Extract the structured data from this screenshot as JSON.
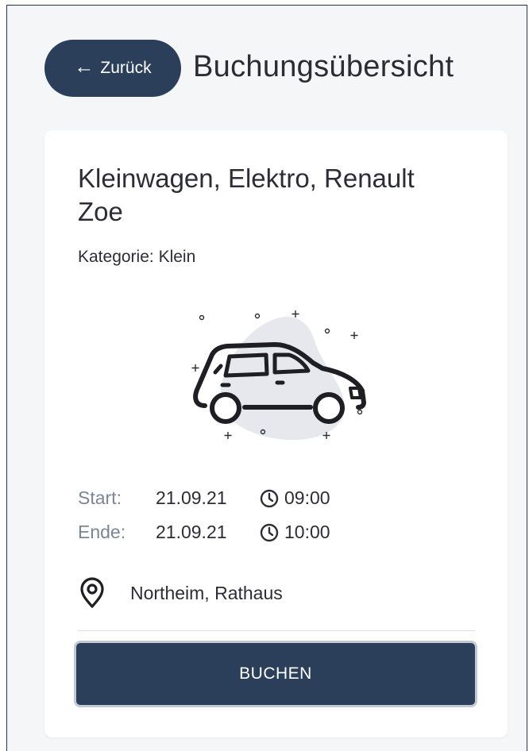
{
  "header": {
    "back_label": "Zurück",
    "back_arrow": "←",
    "title": "Buchungsübersicht"
  },
  "booking": {
    "car_name": "Kleinwagen, Elektro, Renault Zoe",
    "category": "Kategorie: Klein",
    "start": {
      "label": "Start:",
      "date": "21.09.21",
      "time": "09:00"
    },
    "end": {
      "label": "Ende:",
      "date": "21.09.21",
      "time": "10:00"
    },
    "location": "Northeim, Rathaus",
    "book_label": "BUCHEN"
  },
  "icons": {
    "back": "arrow-left-icon",
    "clock": "clock-icon",
    "location": "map-pin-icon",
    "illustration": "car-illustration"
  },
  "colors": {
    "primary": "#2b3f5a",
    "background": "#f5f6f8",
    "card": "#ffffff",
    "muted_text": "#7c8593"
  }
}
